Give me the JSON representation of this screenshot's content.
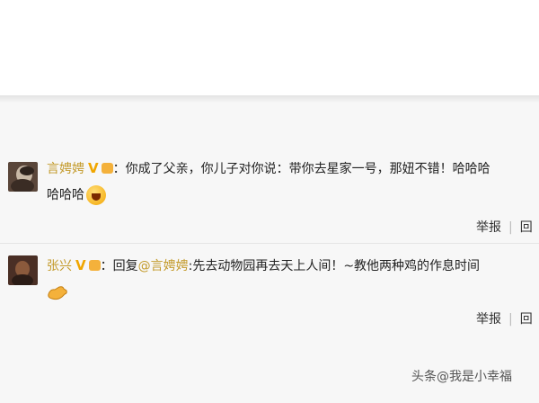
{
  "comments": [
    {
      "username": "言娉娉",
      "verified": "V",
      "text": "：你成了父亲，你儿子对你说：带你去星家一号，那妞不错！哈哈哈",
      "continuation": "哈哈哈",
      "actions": {
        "report": "举报",
        "reply": "回"
      }
    },
    {
      "username": "张兴",
      "verified": "V",
      "reply_prefix": "：回复",
      "mention": "@言娉娉",
      "text": ":先去动物园再去天上人间！~教他两种鸡的作息时间",
      "actions": {
        "report": "举报",
        "reply": "回"
      }
    }
  ],
  "watermark": "头条@我是小幸福",
  "icons": [
    "avatar",
    "verified-badge",
    "level-icon",
    "laughing-emoji",
    "pointing-hand-emoji"
  ],
  "colors": {
    "username": "#c39a2a",
    "badge": "#f0a600",
    "background": "#f7f7f7"
  }
}
